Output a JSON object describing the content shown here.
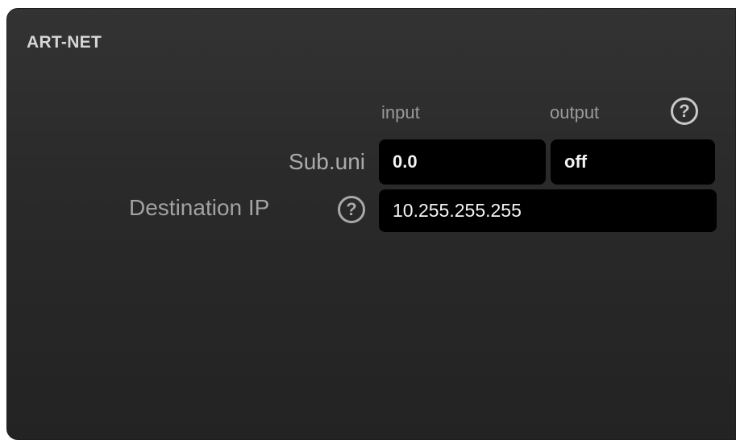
{
  "panel": {
    "title": "ART-NET",
    "columns": {
      "input": "input",
      "output": "output"
    },
    "help_glyph": "?",
    "sub_uni": {
      "label": "Sub.uni",
      "input_value": "0.0",
      "output_value": "off"
    },
    "destination": {
      "label": "Destination IP",
      "value": "10.255.255.255"
    }
  },
  "icons": {
    "help": "question-circle-icon"
  },
  "colors": {
    "panel_bg": "#2a2a2a",
    "field_bg": "#000000",
    "label_text": "#a2a2a2",
    "field_text": "#f4f4f4"
  }
}
